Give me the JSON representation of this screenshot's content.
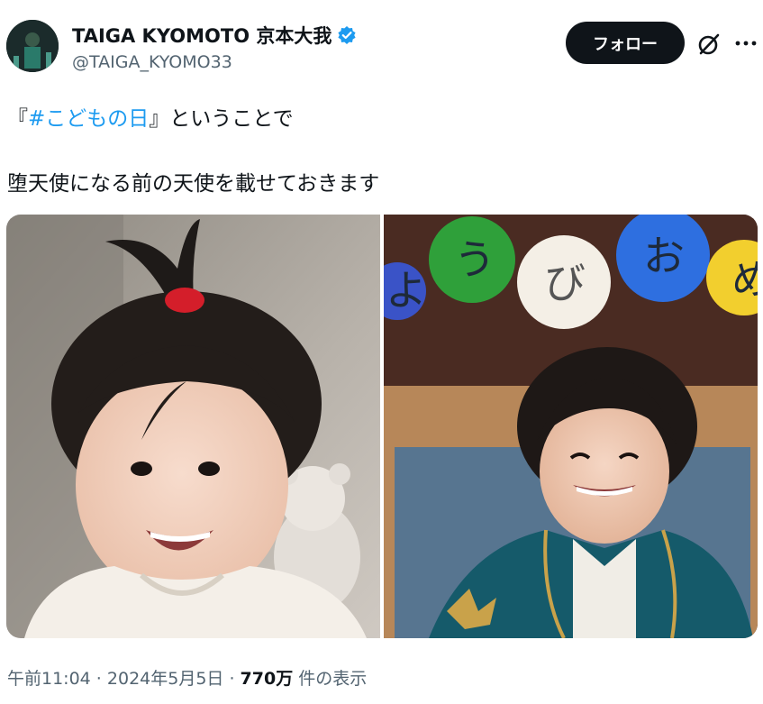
{
  "author": {
    "display_name": "TAIGA KYOMOTO 京本大我",
    "handle": "@TAIGA_KYOMO33",
    "verified": true,
    "avatar_icon": "profile-photo"
  },
  "actions": {
    "follow_label": "フォロー",
    "grok_icon": "grok-icon",
    "more_icon": "more-icon"
  },
  "tweet": {
    "line1_open": "『",
    "line1_hashtag": "#こどもの日",
    "line1_rest": "』ということで",
    "line2": "堕天使になる前の天使を載せておきます"
  },
  "media": {
    "photo_count": 2,
    "right_photo_letters": [
      "よ",
      "う",
      "び",
      "お",
      "め"
    ]
  },
  "meta": {
    "time": "午前11:04",
    "sep1": " · ",
    "date": "2024年5月5日",
    "sep2": " · ",
    "views": "770万",
    "views_suffix": " 件の表示"
  },
  "colors": {
    "accent": "#1d9bf0",
    "text": "#0f1419",
    "secondary": "#536471",
    "follow_bg": "#0f1419"
  }
}
